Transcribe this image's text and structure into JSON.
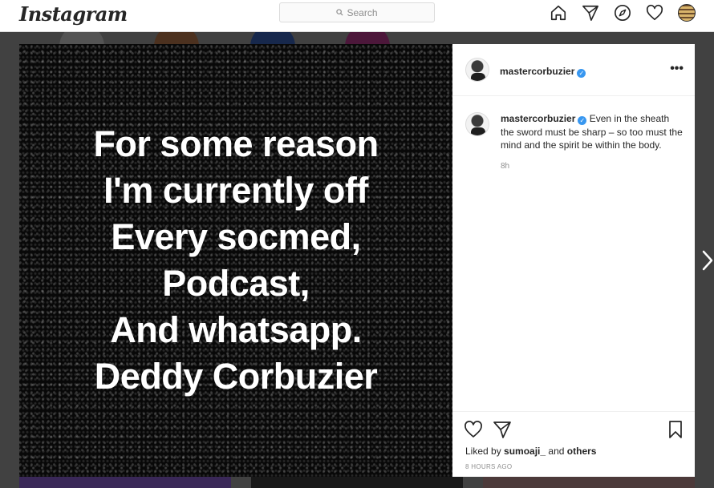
{
  "header": {
    "logo": "Instagram",
    "search_placeholder": "Search"
  },
  "post": {
    "image_text": [
      "For some reason",
      "I'm currently off",
      "Every socmed,",
      "Podcast,",
      "And whatsapp.",
      "Deddy Corbuzier"
    ],
    "author": "mastercorbuzier",
    "caption": "Even in the sheath the sword must be sharp – so too must the mind and the spirit be within the body.",
    "comment_age": "8h",
    "liked_by_prefix": "Liked by",
    "liked_by_user": "sumoaji_",
    "liked_by_and": "and",
    "liked_by_others": "others",
    "time_ago": "8 HOURS AGO",
    "more_symbol": "•••"
  },
  "icons": {
    "nav": [
      "home-icon",
      "direct-icon",
      "explore-icon",
      "heart-icon",
      "profile-avatar"
    ],
    "actions": [
      "like-icon",
      "share-icon",
      "save-icon"
    ],
    "next": "chevron-right-icon"
  },
  "colors": {
    "verified": "#3897f0",
    "border": "#dbdbdb",
    "secondary_text": "#8e8e8e"
  }
}
